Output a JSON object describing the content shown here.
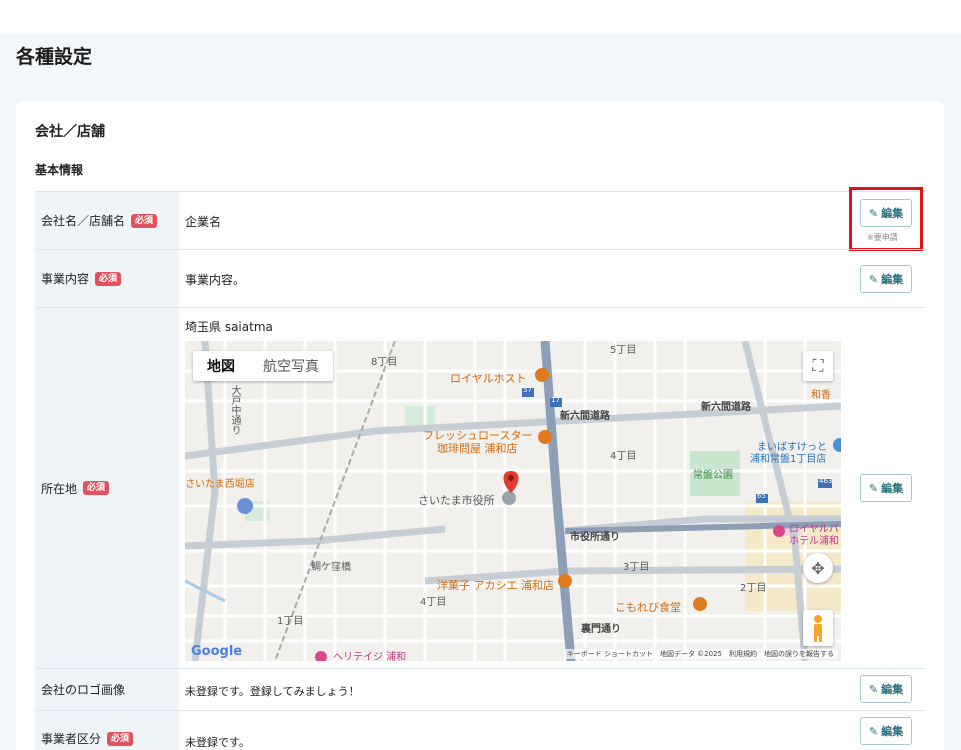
{
  "page": {
    "title": "各種設定"
  },
  "section": {
    "title": "会社／店舗",
    "subtitle": "基本情報"
  },
  "required_badge": "必須",
  "edit_label": "編集",
  "edit_note": "※要申請",
  "rows": [
    {
      "label": "会社名／店舗名",
      "required": true,
      "value": "企業名"
    },
    {
      "label": "事業内容",
      "required": true,
      "value": "事業内容。"
    },
    {
      "label": "所在地",
      "required": true,
      "value": "埼玉県 saiatma"
    },
    {
      "label": "会社のロゴ画像",
      "required": false,
      "value": "未登録です。登録してみましょう！"
    },
    {
      "label": "事業者区分",
      "required": true,
      "value": "未登録です。"
    }
  ],
  "map": {
    "tabs": [
      "地図",
      "航空写真"
    ],
    "fullscreen_icon": "fullscreen-icon",
    "pan_icon": "pan-control-icon",
    "pegman_icon": "pegman-icon",
    "logo": "Google",
    "footer": "キーボード ショートカット　地図データ ©2025　利用規約　地図の誤りを報告する",
    "labels": {
      "l8chome": "8丁目",
      "l5chome": "5丁目",
      "royal_host": "ロイヤルホスト",
      "wako": "和香",
      "shinroku1": "新六間道路",
      "shinroku2": "新六間道路",
      "fresh1": "フレッシュロースター",
      "fresh2": "珈琲問屋 浦和店",
      "l4chome_a": "4丁目",
      "jobanpark": "常盤公園",
      "maibasu1": "まいばすけっと",
      "maibasu2": "浦和常盤1丁目店",
      "saitama_nishi": "さいたま西堀店",
      "cityhall": "さいたま市役所",
      "shiyakusho": "市役所通り",
      "royal_hotel1": "ロイヤルパ",
      "royal_hotel2": "ホテル浦和",
      "kamegakubo": "鯛ケ窪橋",
      "yogashi": "洋菓子 アカシエ 浦和店",
      "l3chome": "3丁目",
      "l4chome_b": "4丁目",
      "l2chome": "2丁目",
      "komorebi": "こもれび食堂",
      "l1chome": "1丁目",
      "uramon": "裏門通り",
      "heritage": "ヘリテイジ 浦和",
      "route57": "57",
      "route17": "17",
      "route65": "65",
      "route463": "463",
      "oto": "大戸中通り"
    }
  }
}
